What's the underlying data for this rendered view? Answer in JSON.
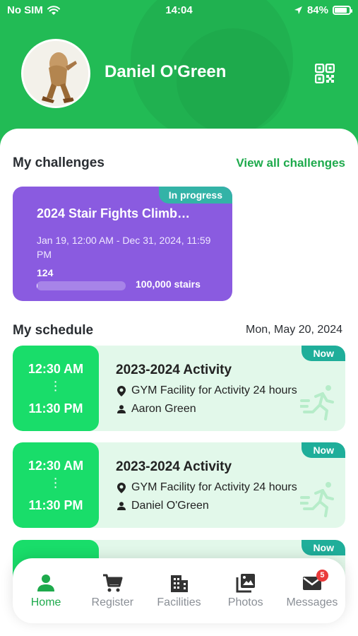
{
  "status_bar": {
    "carrier": "No SIM",
    "time": "14:04",
    "battery": "84%",
    "battery_level": 0.84
  },
  "profile": {
    "name": "Daniel O'Green"
  },
  "challenges": {
    "title": "My challenges",
    "view_all": "View all challenges",
    "items": [
      {
        "badge": "In progress",
        "title": "2024 Stair Fights Climb…",
        "dates": "Jan 19, 12:00 AM - Dec 31, 2024, 11:59 PM",
        "current": "124",
        "goal": "100,000 stairs",
        "progress": 0.00124
      }
    ]
  },
  "schedule": {
    "title": "My schedule",
    "date": "Mon, May 20, 2024",
    "items": [
      {
        "start": "12:30 AM",
        "end": "11:30 PM",
        "badge": "Now",
        "title": "2023-2024 Activity",
        "facility": "GYM Facility for Activity 24 hours",
        "person": "Aaron Green"
      },
      {
        "start": "12:30 AM",
        "end": "11:30 PM",
        "badge": "Now",
        "title": "2023-2024 Activity",
        "facility": "GYM Facility for Activity 24 hours",
        "person": "Daniel O'Green"
      },
      {
        "badge": "Now"
      }
    ]
  },
  "nav": {
    "items": [
      {
        "label": "Home",
        "icon": "person-icon",
        "active": true
      },
      {
        "label": "Register",
        "icon": "cart-icon"
      },
      {
        "label": "Facilities",
        "icon": "building-icon"
      },
      {
        "label": "Photos",
        "icon": "photos-icon"
      },
      {
        "label": "Messages",
        "icon": "mail-icon",
        "badge": "5"
      }
    ]
  },
  "colors": {
    "primary_green": "#22bb55",
    "challenge_purple": "#8a5be0",
    "time_green": "#19dd6a",
    "card_bg": "#e2f8ea",
    "badge_teal": "#1fae9a"
  }
}
